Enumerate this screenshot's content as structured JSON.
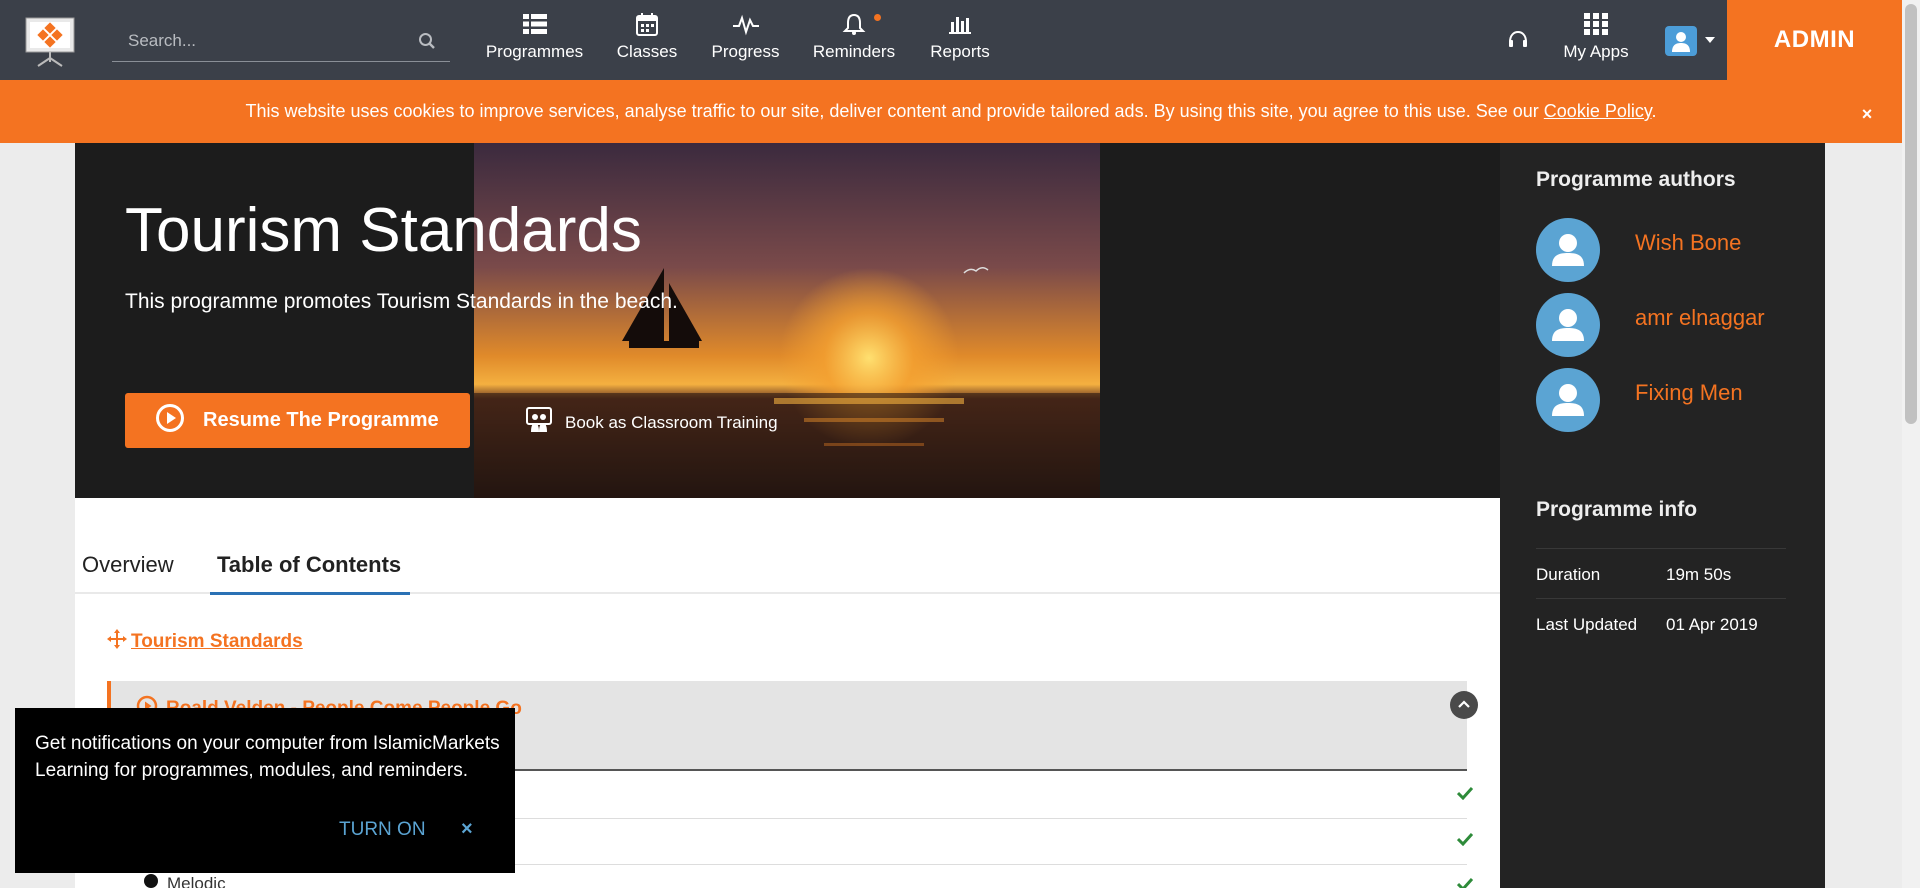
{
  "header": {
    "search_placeholder": "Search...",
    "nav": [
      {
        "label": "Programmes",
        "icon": "list-grid-icon"
      },
      {
        "label": "Classes",
        "icon": "calendar-icon"
      },
      {
        "label": "Progress",
        "icon": "pulse-icon"
      },
      {
        "label": "Reminders",
        "icon": "bell-icon"
      },
      {
        "label": "Reports",
        "icon": "bar-chart-icon"
      }
    ],
    "my_apps_label": "My Apps",
    "admin_label": "ADMIN"
  },
  "cookie_bar": {
    "text": "This website uses cookies to improve services, analyse traffic to our site, deliver content and provide tailored ads. By using this site, you agree to this use. See our ",
    "link_text": "Cookie Policy",
    "suffix": ".",
    "close": "×"
  },
  "hero": {
    "title": "Tourism Standards",
    "subtitle": "This programme promotes Tourism Standards in the beach.",
    "resume_label": "Resume The Programme",
    "book_label": "Book as Classroom Training"
  },
  "sidebar": {
    "authors_heading": "Programme authors",
    "authors": [
      "Wish Bone",
      "amr elnaggar",
      "Fixing Men"
    ],
    "info_heading": "Programme info",
    "info": [
      {
        "key": "Duration",
        "value": "19m 50s"
      },
      {
        "key": "Last Updated",
        "value": "01 Apr 2019"
      }
    ]
  },
  "tabs": {
    "overview": "Overview",
    "toc": "Table of Contents"
  },
  "toc": {
    "root": "Tourism Standards",
    "module_title": "Roald Velden - People Come People Go",
    "lesson_partial": "Melodic"
  },
  "notification": {
    "message": "Get notifications on your computer from IslamicMarkets Learning for programmes, modules, and reminders.",
    "turn_on": "TURN ON",
    "close": "×"
  },
  "colors": {
    "accent": "#f47321",
    "nav_bg": "#3b4049",
    "sidebar_bg": "#232323",
    "link_blue": "#5ba4d3",
    "tab_underline": "#2a71b5"
  }
}
